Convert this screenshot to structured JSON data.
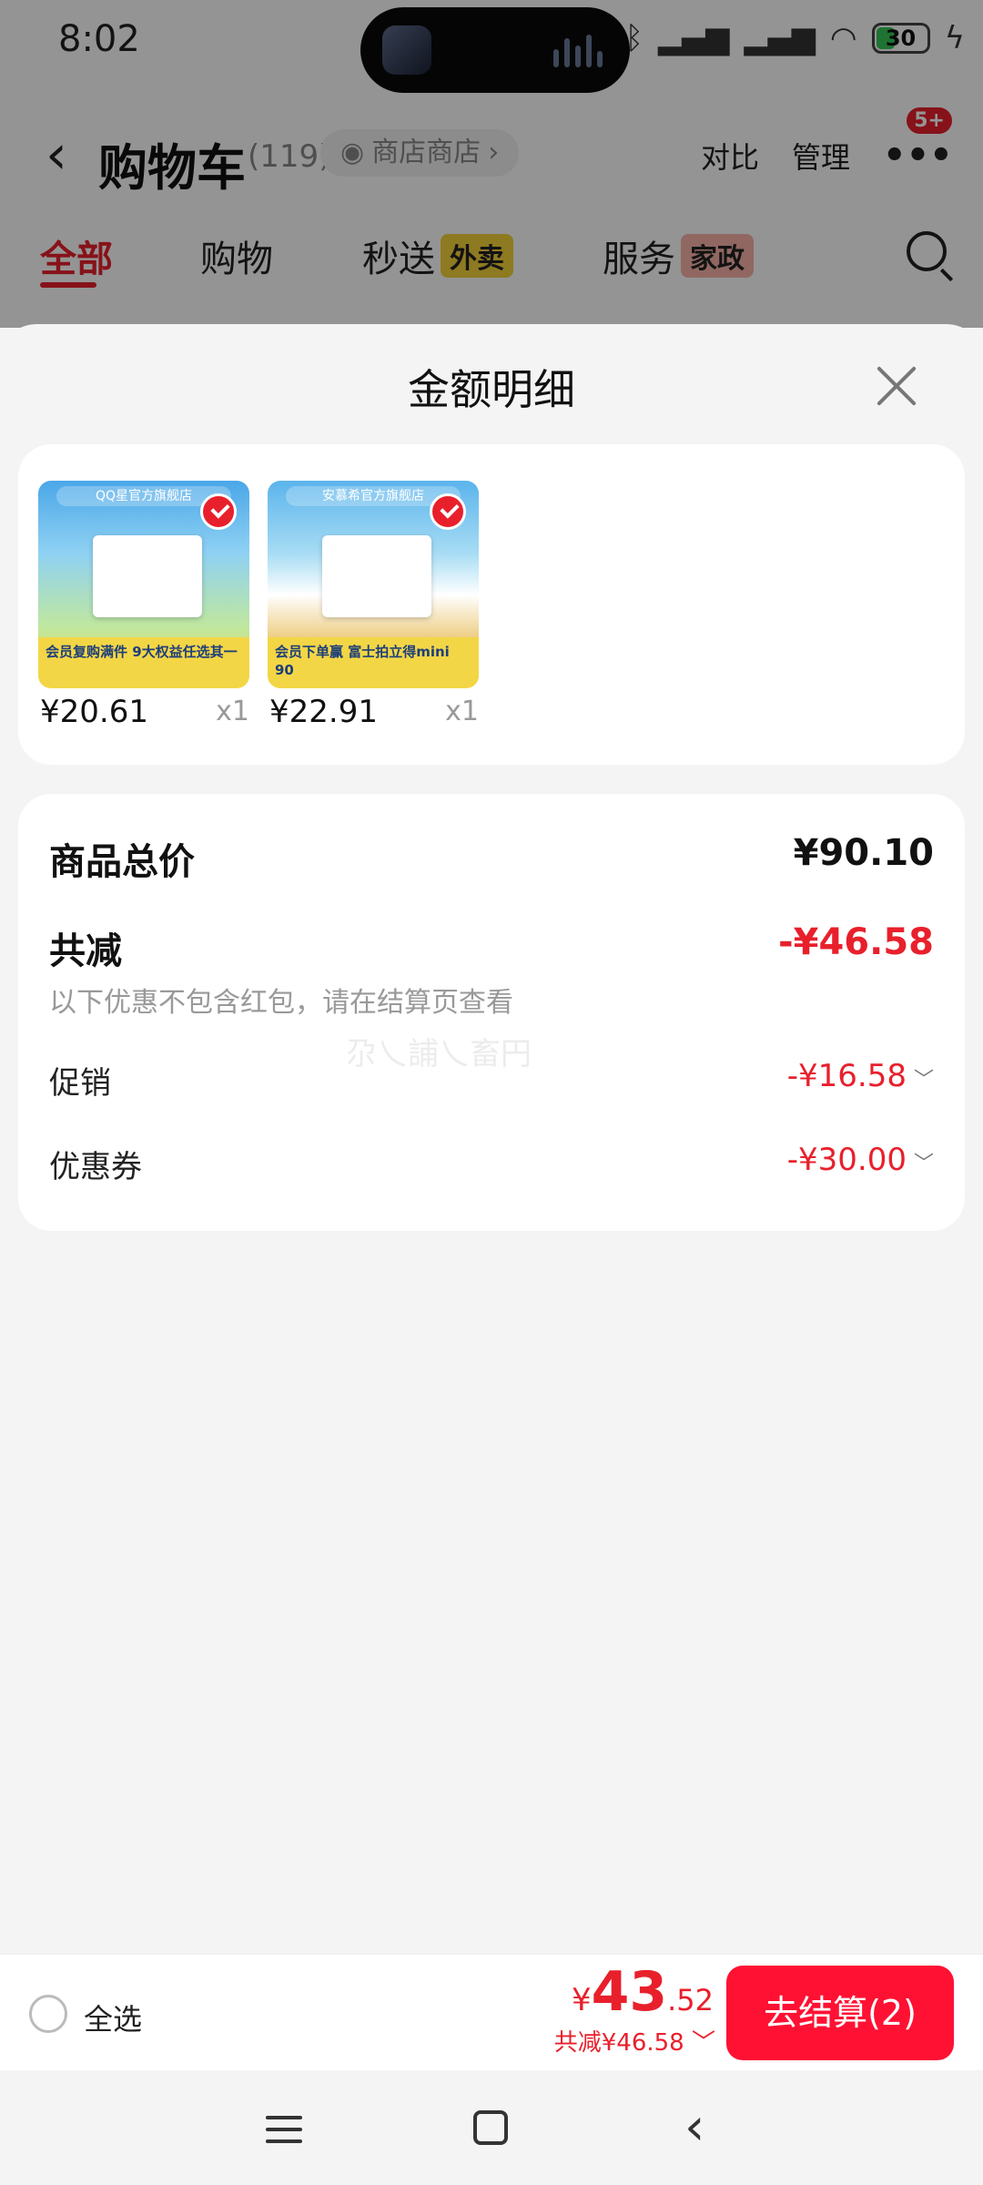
{
  "status_bar": {
    "time": "8:02",
    "battery": "30"
  },
  "header": {
    "back_glyph": "‹",
    "title": "购物车",
    "count": "(119)",
    "shop_chip": "商店商店",
    "compare": "对比",
    "manage": "管理",
    "more_glyph": "•••",
    "badge": "5+"
  },
  "tabs": [
    {
      "label": "全部"
    },
    {
      "label": "购物"
    },
    {
      "label": "秒送",
      "tag": "外卖"
    },
    {
      "label": "服务",
      "tag": "家政"
    }
  ],
  "sheet": {
    "title": "金额明细",
    "products": [
      {
        "banner": "QQ星官方旗舰店",
        "footer": "会员复购满件 9大权益任选其一",
        "price": "¥20.61",
        "qty": "x1"
      },
      {
        "banner": "安慕希官方旗舰店",
        "footer": "会员下单赢 富士拍立得mini 90",
        "price": "¥22.91",
        "qty": "x1"
      }
    ],
    "summary": {
      "total_label": "商品总价",
      "total_value": "¥90.10",
      "reduce_label": "共减",
      "reduce_value": "-¥46.58",
      "note": "以下优惠不包含红包，请在结算页查看",
      "watermark": "尕乀誧乀畜円",
      "promo_label": "促销",
      "promo_value": "-¥16.58",
      "coupon_label": "优惠券",
      "coupon_value": "-¥30.00",
      "chevron": "﹀"
    }
  },
  "bottom_bar": {
    "select_all": "全选",
    "yen": "¥",
    "total_int": "43",
    "total_dec": ".52",
    "discount": "共减¥46.58 ﹀",
    "checkout": "去结算(2)"
  },
  "colors": {
    "accent": "#e8202c",
    "checkout": "#ff1133"
  }
}
